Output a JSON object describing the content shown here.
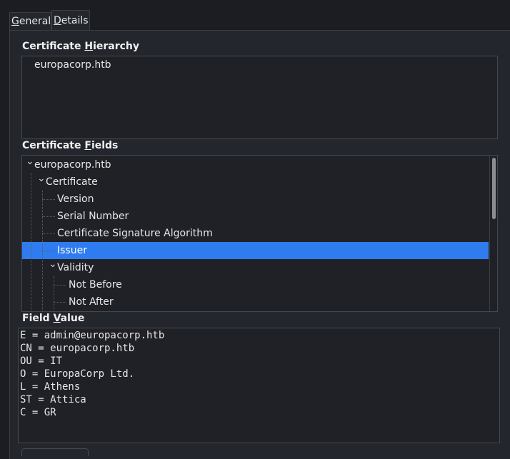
{
  "tabs": {
    "general": {
      "label_pre": "",
      "label_u": "G",
      "label_post": "eneral"
    },
    "details": {
      "label_pre": "",
      "label_u": "D",
      "label_post": "etails"
    }
  },
  "hierarchy": {
    "label_pre": "Certificate ",
    "label_u": "H",
    "label_post": "ierarchy",
    "items": [
      "europacorp.htb"
    ]
  },
  "fields": {
    "label_pre": "Certificate ",
    "label_u": "F",
    "label_post": "ields",
    "rows": [
      {
        "label": "europacorp.htb",
        "level": 0,
        "expanded": true,
        "selected": false
      },
      {
        "label": "Certificate",
        "level": 1,
        "expanded": true,
        "selected": false
      },
      {
        "label": "Version",
        "level": 2,
        "expanded": null,
        "selected": false
      },
      {
        "label": "Serial Number",
        "level": 2,
        "expanded": null,
        "selected": false
      },
      {
        "label": "Certificate Signature Algorithm",
        "level": 2,
        "expanded": null,
        "selected": false
      },
      {
        "label": "Issuer",
        "level": 2,
        "expanded": null,
        "selected": true
      },
      {
        "label": "Validity",
        "level": 2,
        "expanded": true,
        "selected": false
      },
      {
        "label": "Not Before",
        "level": 3,
        "expanded": null,
        "selected": false
      },
      {
        "label": "Not After",
        "level": 3,
        "expanded": null,
        "selected": false
      }
    ]
  },
  "field_value": {
    "label_pre": "Field ",
    "label_u": "V",
    "label_post": "alue",
    "lines": [
      "E = admin@europacorp.htb",
      "CN = europacorp.htb",
      "OU = IT",
      "O = EuropaCorp Ltd.",
      "L = Athens",
      "ST = Attica",
      "C = GR"
    ]
  },
  "colors": {
    "selection": "#2f7bf0",
    "background": "#23262d"
  }
}
